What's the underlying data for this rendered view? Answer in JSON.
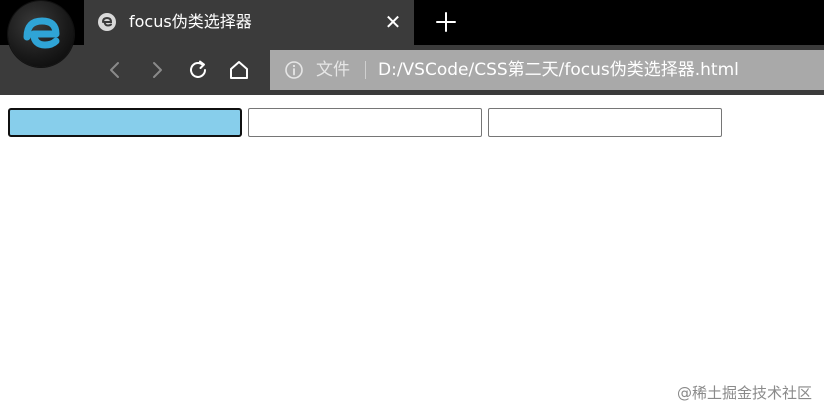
{
  "tab": {
    "title": "focus伪类选择器",
    "close_glyph": "✕"
  },
  "icons": {
    "browser_logo": "edge-logo-icon",
    "favicon": "page-favicon-icon",
    "close": "close-icon",
    "new_tab": "plus-icon",
    "back": "back-arrow-icon",
    "forward": "forward-arrow-icon",
    "reload": "reload-icon",
    "home": "home-icon",
    "info": "info-icon"
  },
  "address_bar": {
    "scheme_label": "文件",
    "url": "D:/VSCode/CSS第二天/focus伪类选择器.html"
  },
  "page": {
    "inputs": [
      {
        "value": "",
        "focused": true
      },
      {
        "value": "",
        "focused": false
      },
      {
        "value": "",
        "focused": false
      }
    ],
    "focus_background": "#87ceeb"
  },
  "watermark": "@稀土掘金技术社区",
  "colors": {
    "titlebar": "#000000",
    "toolbar": "#3b3b3b",
    "address_bar": "#a9a9a9",
    "logo_accent": "#2fa4d6"
  }
}
